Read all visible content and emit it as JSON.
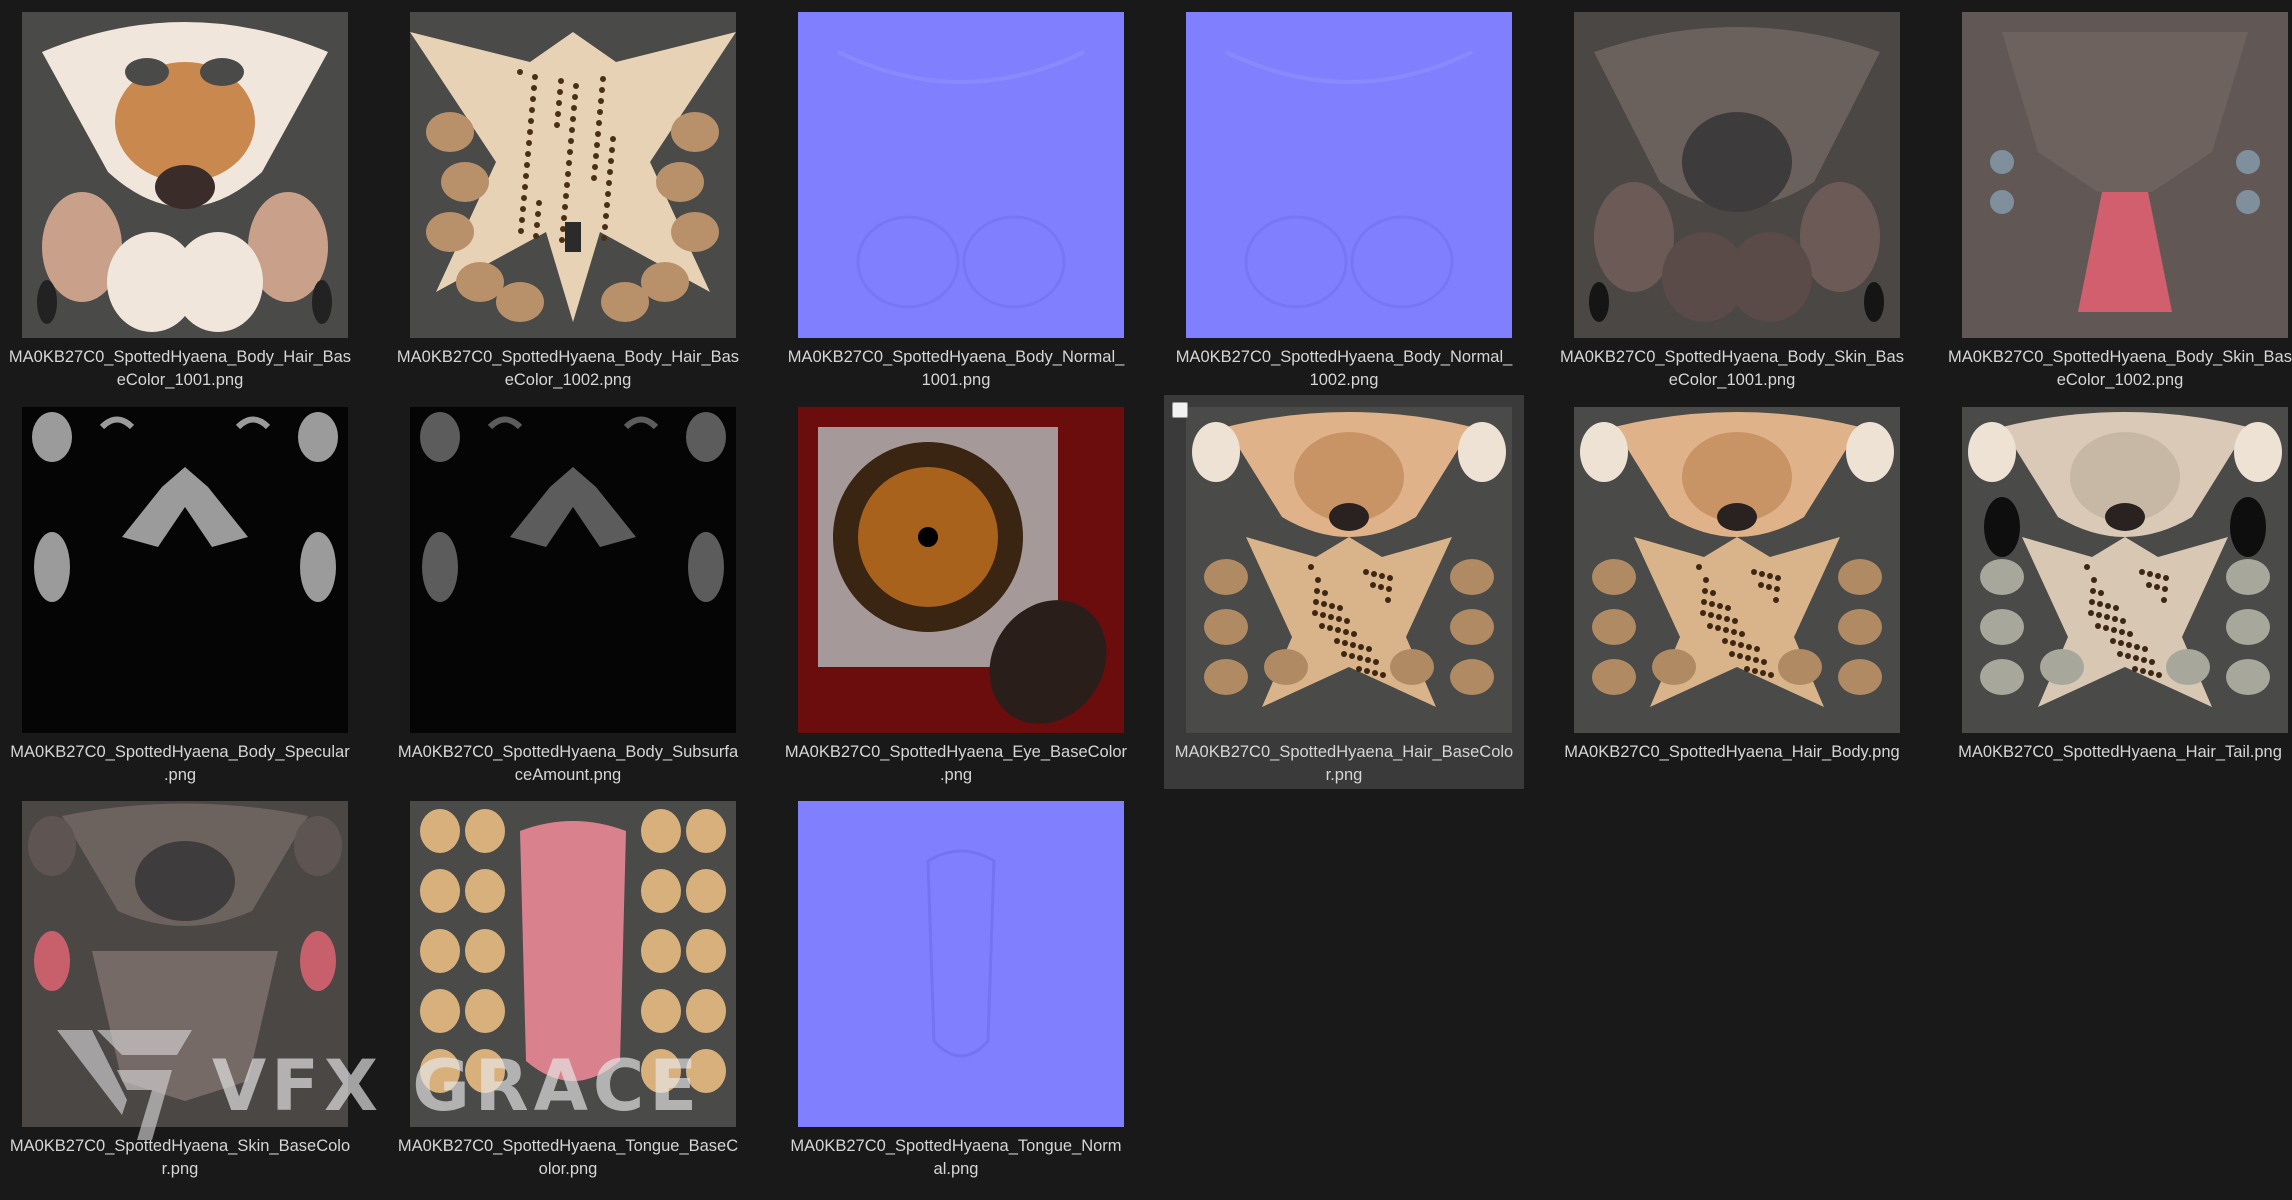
{
  "files": [
    {
      "name": "MA0KB27C0_SpottedHyaena_Body_Hair_Bas\neColor_1001.png",
      "kind": "hair-face"
    },
    {
      "name": "MA0KB27C0_SpottedHyaena_Body_Hair_Bas\neColor_1002.png",
      "kind": "hair-body"
    },
    {
      "name": "MA0KB27C0_SpottedHyaena_Body_Normal_\n1001.png",
      "kind": "normal"
    },
    {
      "name": "MA0KB27C0_SpottedHyaena_Body_Normal_\n1002.png",
      "kind": "normal"
    },
    {
      "name": "MA0KB27C0_SpottedHyaena_Body_Skin_Bas\neColor_1001.png",
      "kind": "skin-face"
    },
    {
      "name": "MA0KB27C0_SpottedHyaena_Body_Skin_Bas\neColor_1002.png",
      "kind": "skin-body"
    },
    {
      "name": "MA0KB27C0_SpottedHyaena_Body_Specular\n.png",
      "kind": "specular"
    },
    {
      "name": "MA0KB27C0_SpottedHyaena_Body_Subsurfa\nceAmount.png",
      "kind": "subsurface"
    },
    {
      "name": "MA0KB27C0_SpottedHyaena_Eye_BaseColor\n.png",
      "kind": "eye"
    },
    {
      "name": "MA0KB27C0_SpottedHyaena_Hair_BaseColo\nr.png",
      "kind": "hair-full",
      "selected": true
    },
    {
      "name": "MA0KB27C0_SpottedHyaena_Hair_Body.png",
      "kind": "hair-full"
    },
    {
      "name": "MA0KB27C0_SpottedHyaena_Hair_Tail.png",
      "kind": "hair-full-pale"
    },
    {
      "name": "MA0KB27C0_SpottedHyaena_Skin_BaseColo\nr.png",
      "kind": "skin-full"
    },
    {
      "name": "MA0KB27C0_SpottedHyaena_Tongue_BaseC\nolor.png",
      "kind": "tongue"
    },
    {
      "name": "MA0KB27C0_SpottedHyaena_Tongue_Norm\nal.png",
      "kind": "normal-tongue"
    }
  ],
  "watermark": {
    "text": "VFX GRACE"
  },
  "colors": {
    "background": "#191919",
    "selected_tile": "#3a3a3a",
    "label_text": "#d6d6d6",
    "normal_map": "#8080ff",
    "texture_bg": "#4a4a4a"
  }
}
